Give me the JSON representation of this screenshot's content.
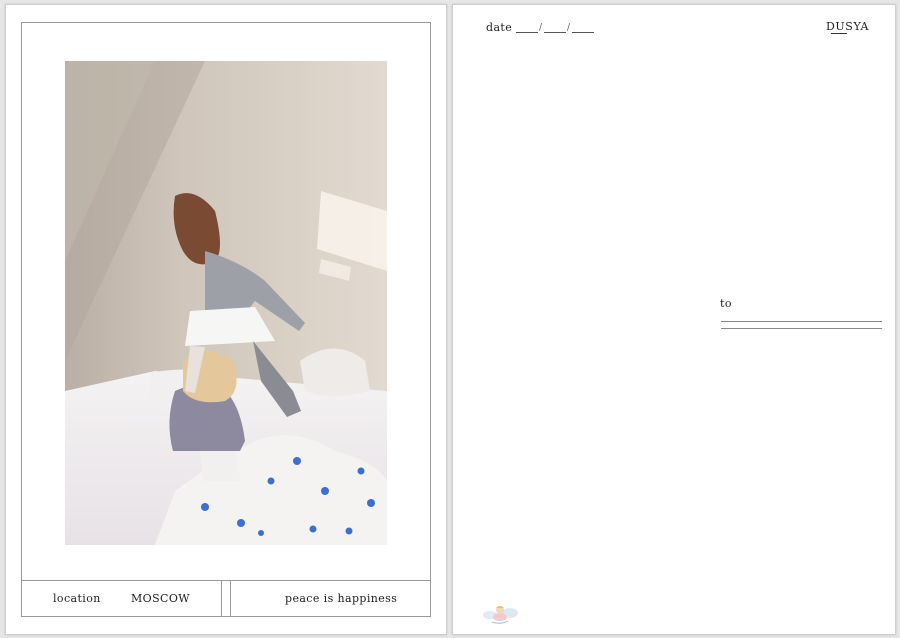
{
  "front": {
    "location_label": "location",
    "location_value": "MOSCOW",
    "motto": "peace is happiness",
    "photo_icon": "bedroom-photo-two-girls"
  },
  "back": {
    "date_label": "date",
    "brand": "DUSYA",
    "to_label": "to",
    "stamp_icon": "angel-icon"
  },
  "colors": {
    "paper": "#ffffff",
    "frame_line": "#9a9a9a",
    "text": "#222222"
  }
}
